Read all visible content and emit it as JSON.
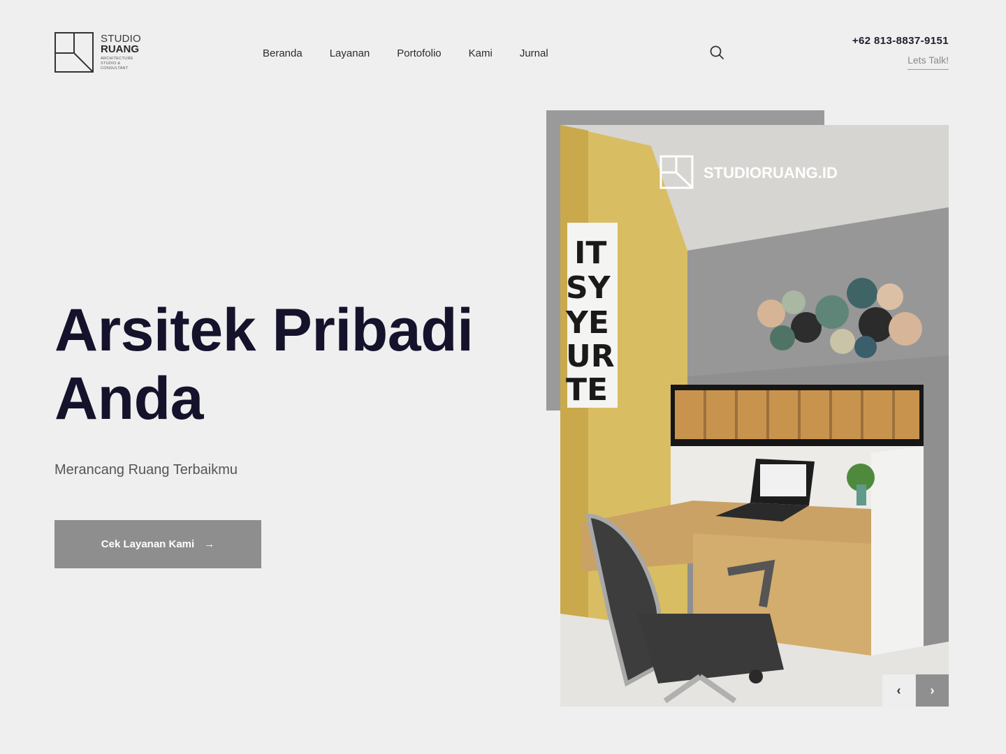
{
  "brand": {
    "name_line1": "STUDIO",
    "name_line2": "RUANG",
    "tagline": "ARCHITECTURE STUDIO & CONSULTANT",
    "logo_icon": "studio-ruang-logo"
  },
  "nav": {
    "items": [
      {
        "label": "Beranda"
      },
      {
        "label": "Layanan"
      },
      {
        "label": "Portofolio"
      },
      {
        "label": "Kami"
      },
      {
        "label": "Jurnal"
      }
    ],
    "search_icon": "search-icon"
  },
  "contact": {
    "phone": "+62 813-8837-9151",
    "cta_label": "Lets Talk!"
  },
  "hero": {
    "title_line1": "Arsitek Pribadi",
    "title_line2": "Anda",
    "subtitle": "Merancang Ruang Terbaikmu",
    "button_label": "Cek Layanan Kami",
    "button_icon": "arrow-right-icon"
  },
  "image": {
    "watermark": "STUDIORUANG.ID",
    "poster_text": "IT SY YE UR TE",
    "prev_icon": "chevron-left-icon",
    "next_icon": "chevron-right-icon",
    "prev_glyph": "‹",
    "next_glyph": "›"
  },
  "colors": {
    "background": "#efefef",
    "heading": "#15132b",
    "button": "#8e8e8e",
    "accent_wall": "#d9bd62"
  }
}
